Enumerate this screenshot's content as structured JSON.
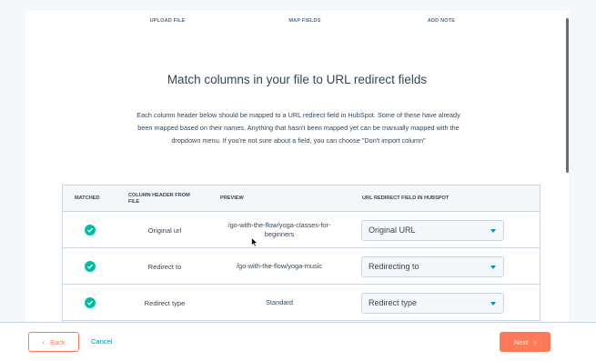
{
  "steps": [
    "UPLOAD FILE",
    "MAP FIELDS",
    "ADD NOTE"
  ],
  "title": "Match columns in your file to URL redirect fields",
  "description": "Each column header below should be mapped to a URL redirect field in HubSpot. Some of these have already been mapped based on their names. Anything that hasn't been mapped yet can be manually mapped with the dropdown menu. If you're not sure about a field, you can choose \"Don't import column\"",
  "table": {
    "headers": [
      "MATCHED",
      "COLUMN HEADER FROM FILE",
      "PREVIEW",
      "URL REDIRECT FIELD IN HUBSPOT"
    ],
    "rows": [
      {
        "column": "Original url",
        "preview": "/go-with-the-flow/yoga-classes-for-beginners",
        "field": "Original URL"
      },
      {
        "column": "Redirect to",
        "preview": "/go-with-the-flow/yoga-music",
        "field": "Redirecting to"
      },
      {
        "column": "Redirect type",
        "preview": "Standard",
        "field": "Redirect type"
      }
    ]
  },
  "footer": {
    "back_label": "Back",
    "cancel_label": "Cancel",
    "next_label": "Next"
  },
  "colors": {
    "accent": "#ff7a59",
    "teal": "#00bda5",
    "link": "#0091ae",
    "text": "#33475b"
  }
}
